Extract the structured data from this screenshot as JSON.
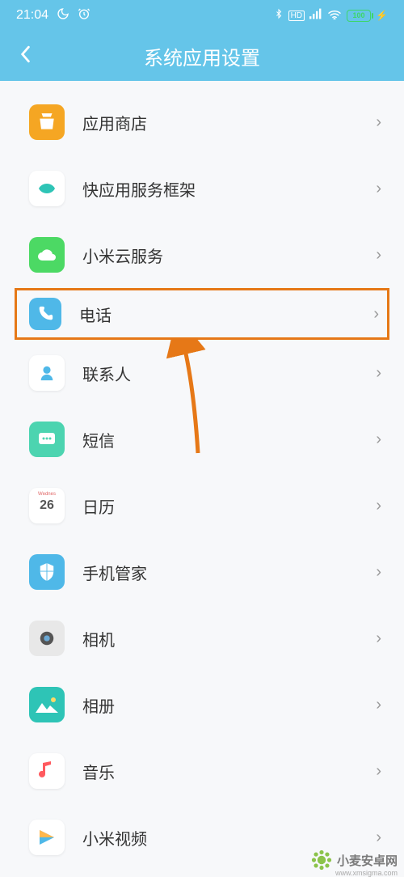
{
  "status": {
    "time": "21:04",
    "battery": "100"
  },
  "header": {
    "title": "系统应用设置"
  },
  "items": [
    {
      "id": "app-store",
      "label": "应用商店",
      "iconBg": "#f5a623"
    },
    {
      "id": "quick-apps",
      "label": "快应用服务框架",
      "iconBg": "#ffffff"
    },
    {
      "id": "mi-cloud",
      "label": "小米云服务",
      "iconBg": "#4cd964"
    },
    {
      "id": "phone",
      "label": "电话",
      "iconBg": "#4fb8e8",
      "highlighted": true
    },
    {
      "id": "contacts",
      "label": "联系人",
      "iconBg": "#ffffff"
    },
    {
      "id": "messages",
      "label": "短信",
      "iconBg": "#4cd4b0"
    },
    {
      "id": "calendar",
      "label": "日历",
      "iconBg": "#ffffff",
      "day": "26"
    },
    {
      "id": "security",
      "label": "手机管家",
      "iconBg": "#4fb8e8"
    },
    {
      "id": "camera",
      "label": "相机",
      "iconBg": "#e8e8e8"
    },
    {
      "id": "gallery",
      "label": "相册",
      "iconBg": "#2ec4b6"
    },
    {
      "id": "music",
      "label": "音乐",
      "iconBg": "#ffffff"
    },
    {
      "id": "mi-video",
      "label": "小米视频",
      "iconBg": "#ffffff"
    }
  ],
  "watermark": {
    "text": "小麦安卓网",
    "url": "www.xmsigma.com"
  }
}
